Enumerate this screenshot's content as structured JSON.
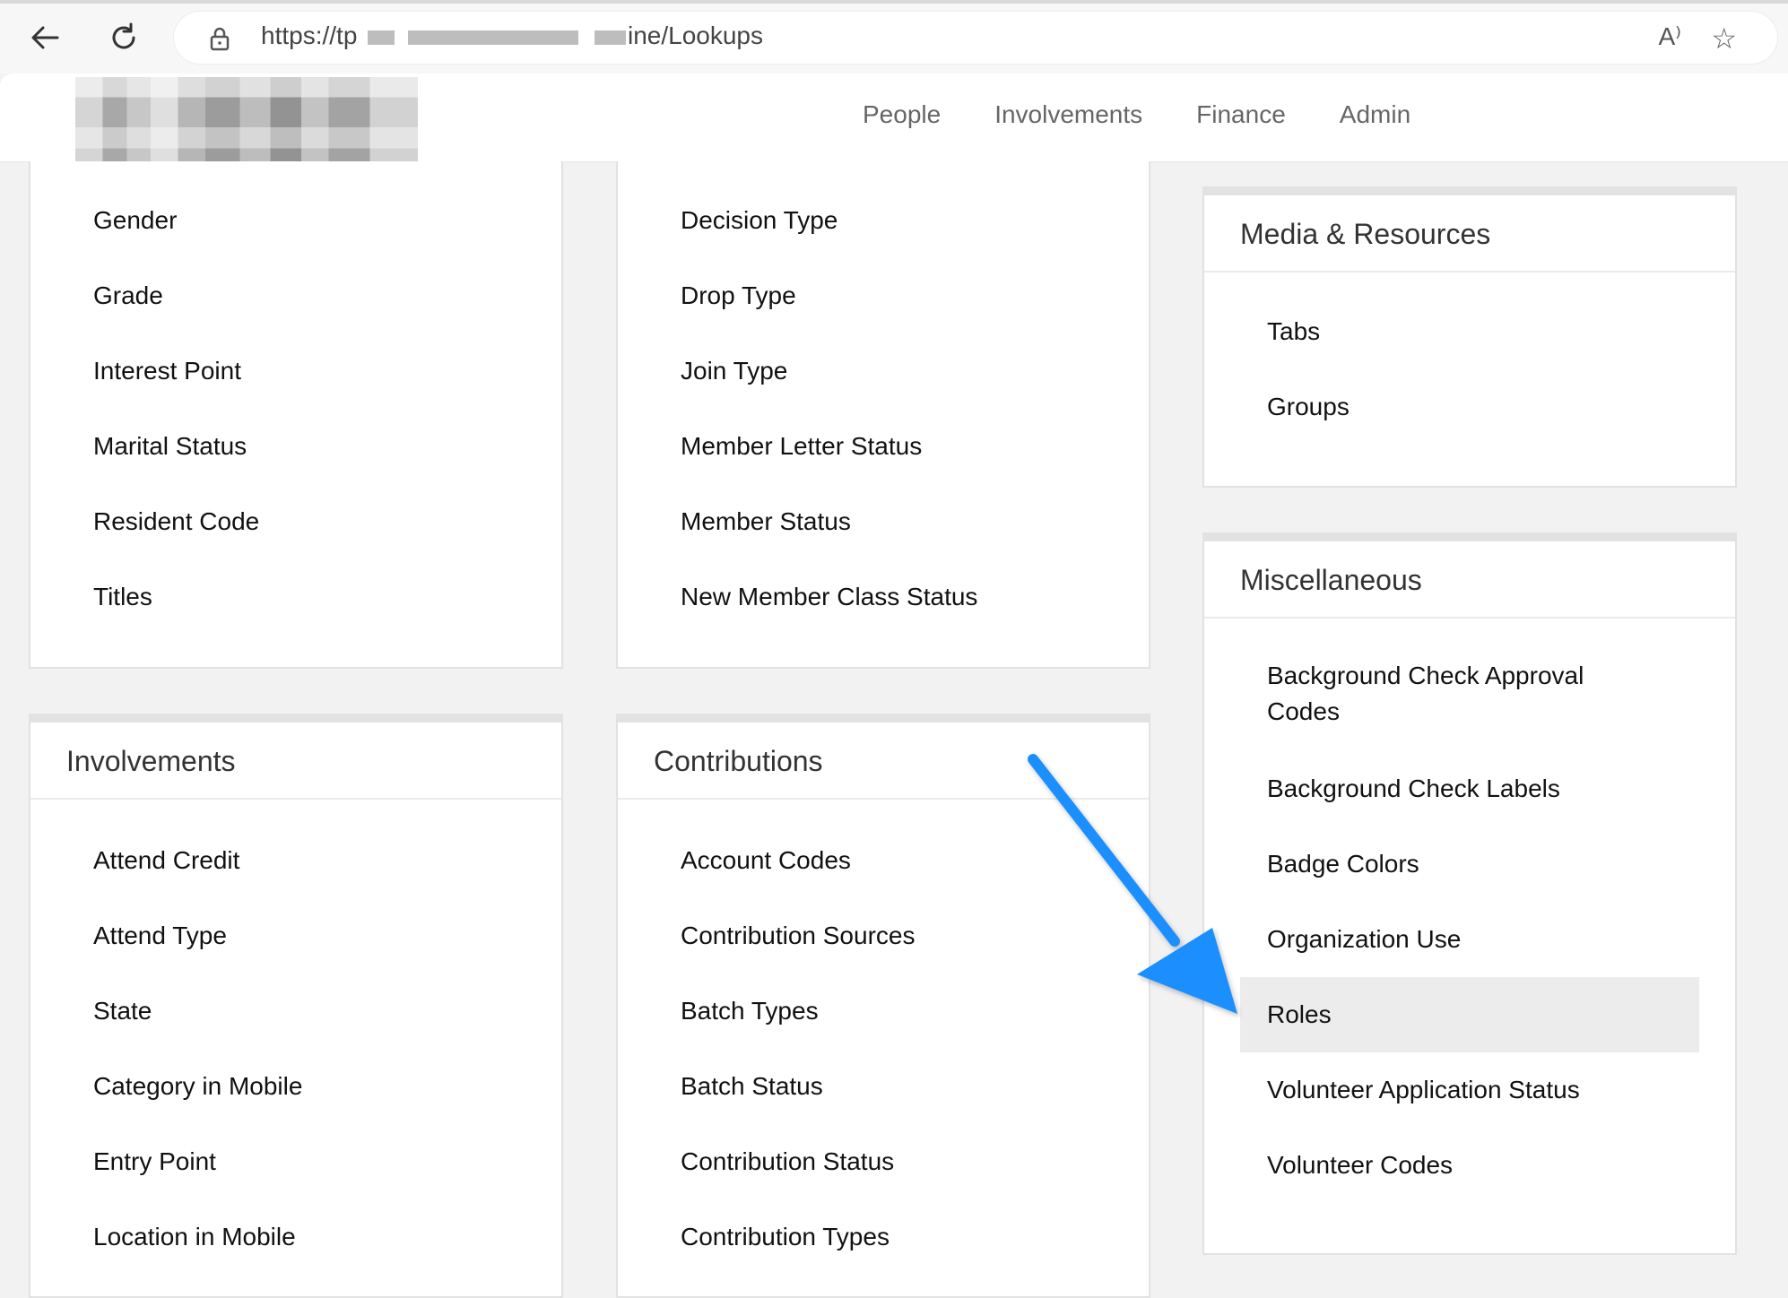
{
  "browser": {
    "url_prefix": "https://tp",
    "url_suffix": "ine/Lookups",
    "read_aloud_label": "A⁾",
    "favorite_glyph": "☆"
  },
  "nav": {
    "items": [
      "People",
      "Involvements",
      "Finance",
      "Admin"
    ]
  },
  "cards": {
    "people_list": [
      "Gender",
      "Grade",
      "Interest Point",
      "Marital Status",
      "Resident Code",
      "Titles"
    ],
    "membership_list": [
      "Decision Type",
      "Drop Type",
      "Join Type",
      "Member Letter Status",
      "Member Status",
      "New Member Class Status"
    ],
    "media": {
      "title": "Media & Resources",
      "items": [
        "Tabs",
        "Groups"
      ]
    },
    "misc": {
      "title": "Miscellaneous",
      "items": [
        "Background Check Approval Codes",
        "Background Check Labels",
        "Badge Colors",
        "Organization Use",
        "Roles",
        "Volunteer Application Status",
        "Volunteer Codes"
      ]
    },
    "involvements": {
      "title": "Involvements",
      "items": [
        "Attend Credit",
        "Attend Type",
        "State",
        "Category in Mobile",
        "Entry Point",
        "Location in Mobile"
      ]
    },
    "contributions": {
      "title": "Contributions",
      "items": [
        "Account Codes",
        "Contribution Sources",
        "Batch Types",
        "Batch Status",
        "Contribution Status",
        "Contribution Types"
      ]
    }
  },
  "colors": {
    "arrow": "#1e8fff",
    "highlight": "#ececec"
  }
}
